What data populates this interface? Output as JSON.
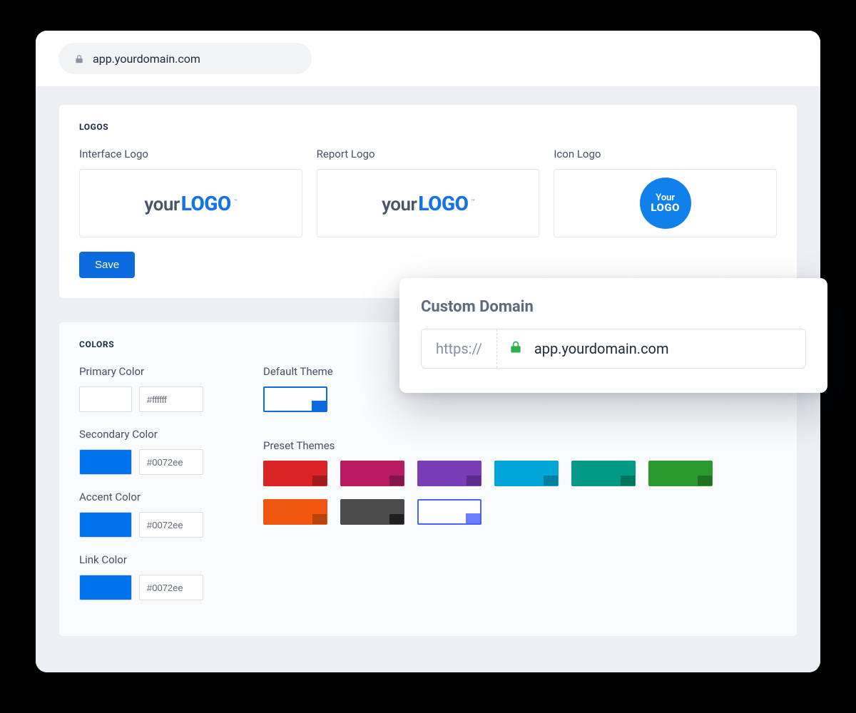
{
  "urlbar": {
    "url": "app.yourdomain.com"
  },
  "logos": {
    "section_title": "LOGOS",
    "interface_label": "Interface Logo",
    "report_label": "Report Logo",
    "icon_label": "Icon Logo",
    "placeholder": {
      "prefix": "your",
      "suffix": "LOGO",
      "tm": "™"
    },
    "icon_placeholder": {
      "line1": "Your",
      "line2": "LOGO"
    },
    "save_label": "Save"
  },
  "colors": {
    "section_title": "COLORS",
    "primary": {
      "label": "Primary Color",
      "hex": "#ffffff",
      "swatch": "#ffffff"
    },
    "secondary": {
      "label": "Secondary Color",
      "hex": "#0072ee",
      "swatch": "#0072ee"
    },
    "accent": {
      "label": "Accent Color",
      "hex": "#0072ee",
      "swatch": "#0072ee"
    },
    "link": {
      "label": "Link Color",
      "hex": "#0072ee",
      "swatch": "#0072ee"
    },
    "default_theme_label": "Default Theme",
    "preset_label": "Preset Themes",
    "presets": [
      {
        "main": "#d92325",
        "corner": "#a31a1c"
      },
      {
        "main": "#b71c62",
        "corner": "#86154a"
      },
      {
        "main": "#7a3db8",
        "corner": "#5c2e8c"
      },
      {
        "main": "#00a7d6",
        "corner": "#007fa3"
      },
      {
        "main": "#009a87",
        "corner": "#00745f"
      },
      {
        "main": "#2a9a2f",
        "corner": "#1f7223"
      },
      {
        "main": "#f0560f",
        "corner": "#b8420c"
      },
      {
        "main": "#4c4c4c",
        "corner": "#1f1f1f"
      }
    ]
  },
  "domain_card": {
    "title": "Custom Domain",
    "scheme": "https://",
    "host": "app.yourdomain.com"
  }
}
